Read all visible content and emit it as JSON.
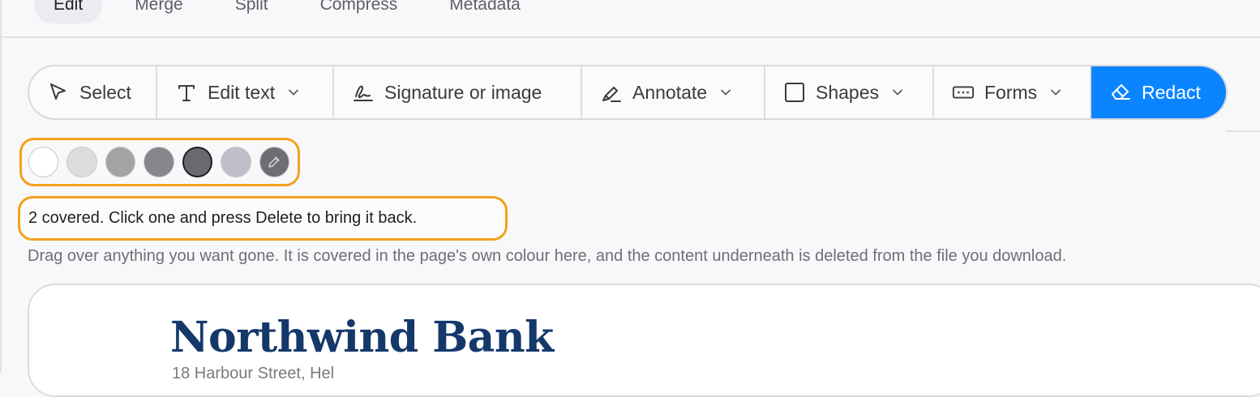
{
  "tabs": [
    {
      "label": "Edit",
      "active": true
    },
    {
      "label": "Merge",
      "active": false
    },
    {
      "label": "Split",
      "active": false
    },
    {
      "label": "Compress",
      "active": false
    },
    {
      "label": "Metadata",
      "active": false
    }
  ],
  "toolbar": {
    "tools": [
      {
        "label": "Select",
        "icon": "cursor-arrow-icon",
        "has_dropdown": false,
        "active": false
      },
      {
        "label": "Edit text",
        "icon": "text-t-icon",
        "has_dropdown": true,
        "active": false
      },
      {
        "label": "Signature or image",
        "icon": "signature-pen-icon",
        "has_dropdown": false,
        "active": false
      },
      {
        "label": "Annotate",
        "icon": "highlighter-icon",
        "has_dropdown": true,
        "active": false
      },
      {
        "label": "Shapes",
        "icon": "square-icon",
        "has_dropdown": true,
        "active": false
      },
      {
        "label": "Forms",
        "icon": "form-field-icon",
        "has_dropdown": true,
        "active": false
      },
      {
        "label": "Redact",
        "icon": "eraser-icon",
        "has_dropdown": false,
        "active": true
      }
    ],
    "active_color": "#0a84ff"
  },
  "redact": {
    "swatches": [
      {
        "color": "#ffffff",
        "selected": false
      },
      {
        "color": "#dcdcde",
        "selected": false
      },
      {
        "color": "#a3a3a6",
        "selected": false
      },
      {
        "color": "#87878b",
        "selected": false
      },
      {
        "color": "#6a6a6e",
        "selected": true
      },
      {
        "color": "#bfbfc9",
        "selected": false
      },
      {
        "color": "#6e6e72",
        "selected": false,
        "icon": "eyedropper-icon"
      }
    ],
    "status": "2 covered. Click one and press Delete to bring it back.",
    "hint": "Drag over anything you want gone. It is covered in the page's own colour here, and the content underneath is deleted from the file you download.",
    "highlight_color": "#f5a01a"
  },
  "document": {
    "bank_name": "Northwind Bank",
    "subtitle": "18 Harbour Street, Hel",
    "title_color": "#14386a"
  }
}
